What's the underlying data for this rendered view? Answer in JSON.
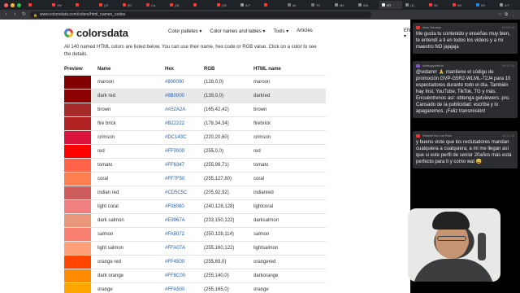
{
  "browser": {
    "tabs": [
      {
        "label": "",
        "color": "#ff3b30"
      },
      {
        "label": "Vid",
        "color": "#ff3b30"
      },
      {
        "label": "",
        "color": "#ff3b30"
      },
      {
        "label": "(37",
        "color": "#ff3b30"
      },
      {
        "label": "(Ei",
        "color": "#ff3b30"
      },
      {
        "label": "Ca",
        "color": "#e53935"
      },
      {
        "label": "(31",
        "color": "#ff3b30"
      },
      {
        "label": "",
        "color": "#ff3b30"
      },
      {
        "label": "(25",
        "color": "#ff3b30"
      },
      {
        "label": "A F",
        "color": "#999999"
      },
      {
        "label": "",
        "color": "#ff3b30"
      },
      {
        "label": "tcl",
        "color": "#777777"
      },
      {
        "label": "TC",
        "color": "#777777"
      },
      {
        "label": "Me",
        "color": "#888888"
      },
      {
        "label": "WA",
        "color": "#888888"
      },
      {
        "label": "HT",
        "color": "#eeeeee"
      },
      {
        "label": "(1)",
        "color": "#888888"
      },
      {
        "label": "Wi",
        "color": "#ff3b30"
      },
      {
        "label": "Wi",
        "color": "#ff3b30"
      },
      {
        "label": "Wi",
        "color": "#1e88e5"
      },
      {
        "label": "A F",
        "color": "#999999"
      },
      {
        "label": "",
        "color": "#888888"
      }
    ],
    "url": "www.colorsdata.com/colors/html_names_codes"
  },
  "site": {
    "logo_text": "colorsdata",
    "nav": {
      "palettes": "Color palletes ▾",
      "names": "Color names and tables ▾",
      "tools": "Tools ▾",
      "articles": "Articles"
    },
    "lang": "EN ▾",
    "intro": "All 140 named HTML colors are listed below. You can use their name, hex code or RGB value. Click on a color to see the details."
  },
  "table": {
    "headers": {
      "preview": "Preview",
      "name": "Name",
      "hex": "Hex",
      "rgb": "RGB",
      "html": "HTML name"
    },
    "rows": [
      {
        "name": "maroon",
        "hex": "#800000",
        "rgb": "(128,0,0)",
        "html": "maroon",
        "color": "#800000"
      },
      {
        "name": "dark red",
        "hex": "#8B0000",
        "rgb": "(139,0,0)",
        "html": "darkred",
        "color": "#8B0000"
      },
      {
        "name": "brown",
        "hex": "#A52A2A",
        "rgb": "(165,42,42)",
        "html": "brown",
        "color": "#A52A2A"
      },
      {
        "name": "fire brick",
        "hex": "#B22222",
        "rgb": "(178,34,34)",
        "html": "firebrick",
        "color": "#B22222"
      },
      {
        "name": "crimson",
        "hex": "#DC143C",
        "rgb": "(220,20,60)",
        "html": "crimson",
        "color": "#DC143C"
      },
      {
        "name": "red",
        "hex": "#FF0000",
        "rgb": "(255,0,0)",
        "html": "red",
        "color": "#FF0000"
      },
      {
        "name": "tomato",
        "hex": "#FF6347",
        "rgb": "(255,99,71)",
        "html": "tomato",
        "color": "#FF6347"
      },
      {
        "name": "coral",
        "hex": "#FF7F50",
        "rgb": "(255,127,80)",
        "html": "coral",
        "color": "#FF7F50"
      },
      {
        "name": "indian red",
        "hex": "#CD5C5C",
        "rgb": "(205,92,92)",
        "html": "indianred",
        "color": "#CD5C5C"
      },
      {
        "name": "light coral",
        "hex": "#F08080",
        "rgb": "(240,128,128)",
        "html": "lightcoral",
        "color": "#F08080"
      },
      {
        "name": "dark salmon",
        "hex": "#E9967A",
        "rgb": "(233,150,122)",
        "html": "darksalmon",
        "color": "#E9967A"
      },
      {
        "name": "salmon",
        "hex": "#FA8072",
        "rgb": "(250,128,114)",
        "html": "salmon",
        "color": "#FA8072"
      },
      {
        "name": "light salmon",
        "hex": "#FFA07A",
        "rgb": "(255,160,122)",
        "html": "lightsalmon",
        "color": "#FFA07A"
      },
      {
        "name": "orange red",
        "hex": "#FF4500",
        "rgb": "(255,69,0)",
        "html": "orangered",
        "color": "#FF4500"
      },
      {
        "name": "dark orange",
        "hex": "#FF8C00",
        "rgb": "(255,140,0)",
        "html": "darkorange",
        "color": "#FF8C00"
      },
      {
        "name": "orange",
        "hex": "#FFA500",
        "rgb": "(255,165,0)",
        "html": "orange",
        "color": "#FFA500"
      }
    ]
  },
  "chat": {
    "messages": [
      {
        "author": "Alan Naranjo",
        "time": "19:09:18",
        "icon_color": "#e53935",
        "text": "Me gusta tu contenido y enseñas muy bien, te entendí a ti en todos los videos y a mi maestro NO jajajaja"
      },
      {
        "author": "shakuyyoshi.tk",
        "time": "19:11:00",
        "icon_color": "#7e57c2",
        "text": "@vidamrr 🙏 mantiene el código de promoción GVP-G5R2-WLML-72J4 para 10 espectadores durante todo el día. También hay Inst, YouTube, TikTok, TG y más. Encuéntrenos así: obtenga getviewers. pro. Cansado de la publicidad: escriba y lo apagaremos. ¡Feliz transmisión!"
      },
      {
        "author": "Gabriel De Los Rios",
        "time": "19:11:24",
        "icon_color": "#e53935",
        "text": "y bueno viste que los reclutadores mandan cualquiera a cualquiera; a mi me llegan así que si este perfil de senior 20años más está perfecto para ti y como wat 😄"
      }
    ]
  }
}
